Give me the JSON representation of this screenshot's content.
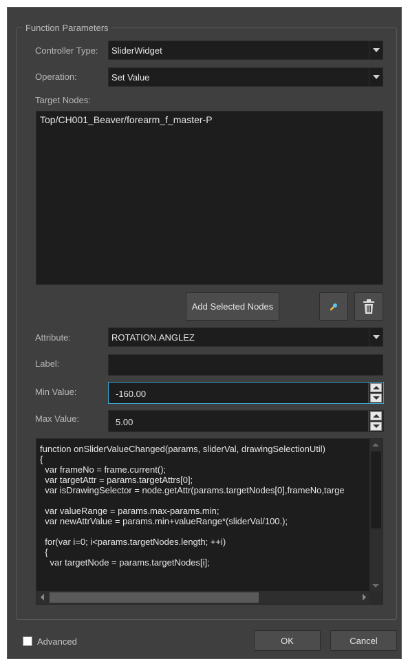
{
  "group_title": "Function Parameters",
  "controller_type": {
    "label": "Controller Type:",
    "value": "SliderWidget"
  },
  "operation": {
    "label": "Operation:",
    "value": "Set Value"
  },
  "target_nodes": {
    "label": "Target Nodes:",
    "items": [
      "Top/CH001_Beaver/forearm_f_master-P"
    ]
  },
  "buttons": {
    "add_selected": "Add Selected Nodes",
    "ok": "OK",
    "cancel": "Cancel"
  },
  "attribute": {
    "label": "Attribute:",
    "value": "ROTATION.ANGLEZ"
  },
  "label_field": {
    "label": "Label:",
    "value": ""
  },
  "min_value": {
    "label": "Min Value:",
    "value": "-160.00"
  },
  "max_value": {
    "label": "Max Value:",
    "value": "5.00"
  },
  "script_lines": [
    "function onSliderValueChanged(params, sliderVal, drawingSelectionUtil)",
    "{",
    "  var frameNo = frame.current();",
    "  var targetAttr = params.targetAttrs[0];",
    "  var isDrawingSelector = node.getAttr(params.targetNodes[0],frameNo,targe",
    "",
    "  var valueRange = params.max-params.min;",
    "  var newAttrValue = params.min+valueRange*(sliderVal/100.);",
    "",
    "  for(var i=0; i<params.targetNodes.length; ++i)",
    "  {",
    "    var targetNode = params.targetNodes[i];"
  ],
  "advanced": {
    "label": "Advanced",
    "checked": false
  },
  "colors": {
    "panel": "#3f3f3f",
    "field": "#1d1d1d",
    "focus_border": "#3aa7d6"
  }
}
